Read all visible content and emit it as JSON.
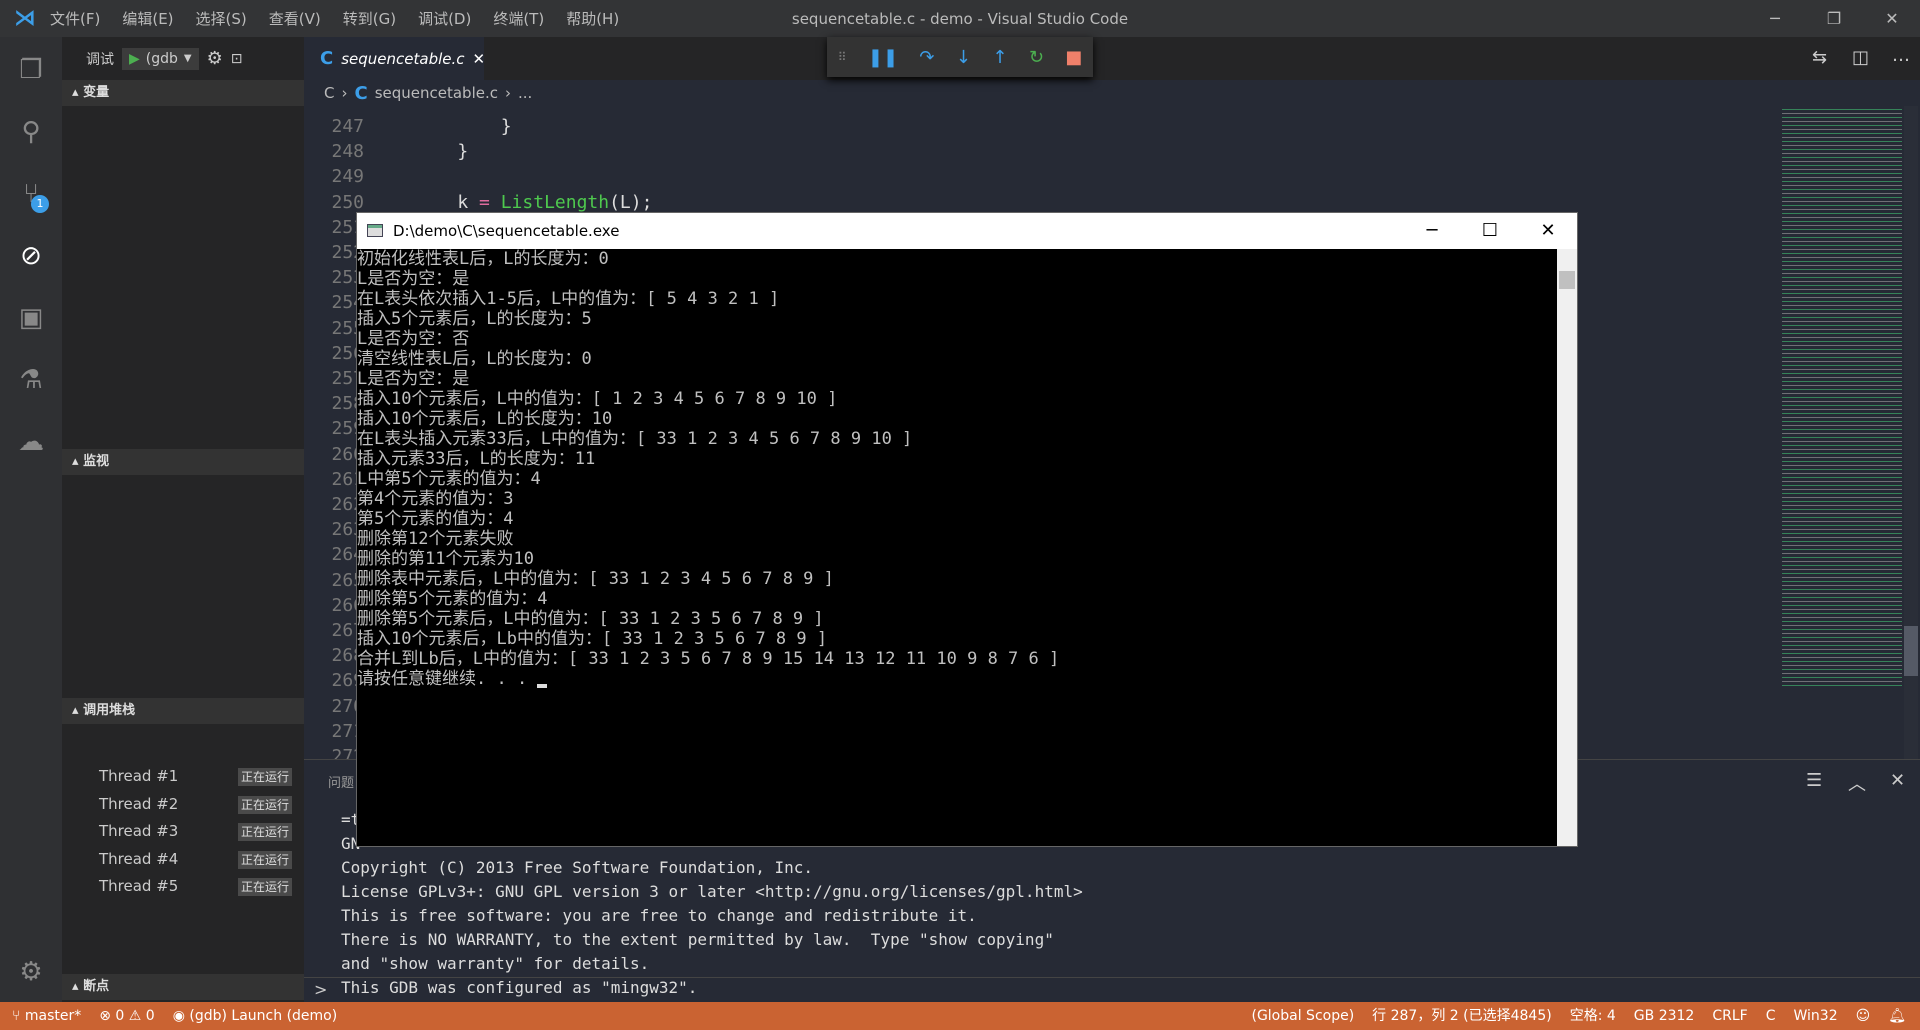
{
  "titlebar": {
    "menus": [
      "文件(F)",
      "编辑(E)",
      "选择(S)",
      "查看(V)",
      "转到(G)",
      "调试(D)",
      "终端(T)",
      "帮助(H)"
    ],
    "title": "sequencetable.c - demo - Visual Studio Code"
  },
  "debug_header": {
    "label": "调试",
    "config": "(gdb"
  },
  "sidebar": {
    "variables": "变量",
    "watch": "监视",
    "callstack": "调用堆栈",
    "breakpoints": "断点",
    "threads": [
      {
        "name": "Thread #1",
        "status": "正在运行"
      },
      {
        "name": "Thread #2",
        "status": "正在运行"
      },
      {
        "name": "Thread #3",
        "status": "正在运行"
      },
      {
        "name": "Thread #4",
        "status": "正在运行"
      },
      {
        "name": "Thread #5",
        "status": "正在运行"
      }
    ]
  },
  "activity": {
    "scm_badge": "1"
  },
  "editor": {
    "tab": "sequencetable.c",
    "breadcrumb": [
      "C",
      "sequencetable.c",
      "..."
    ],
    "lines": [
      {
        "n": "247",
        "code": "        }"
      },
      {
        "n": "248",
        "code": "    }"
      },
      {
        "n": "249",
        "code": ""
      },
      {
        "n": "250",
        "code": "    k = ListLength(L);"
      },
      {
        "n": "251",
        "code": ""
      },
      {
        "n": "252",
        "code": ""
      },
      {
        "n": "253",
        "code": ""
      },
      {
        "n": "254",
        "code": ""
      },
      {
        "n": "255",
        "code": ""
      },
      {
        "n": "256",
        "code": ""
      },
      {
        "n": "257",
        "code": ""
      },
      {
        "n": "258",
        "code": ""
      },
      {
        "n": "259",
        "code": ""
      },
      {
        "n": "260",
        "code": ""
      },
      {
        "n": "261",
        "code": ""
      },
      {
        "n": "262",
        "code": ""
      },
      {
        "n": "263",
        "code": ""
      },
      {
        "n": "264",
        "code": ""
      },
      {
        "n": "265",
        "code": ""
      },
      {
        "n": "266",
        "code": ""
      },
      {
        "n": "267",
        "code": ""
      },
      {
        "n": "268",
        "code": ""
      },
      {
        "n": "269",
        "code": ""
      },
      {
        "n": "270",
        "code": ""
      },
      {
        "n": "271",
        "code": ""
      },
      {
        "n": "272",
        "code": ""
      }
    ]
  },
  "console": {
    "title": "D:\\demo\\C\\sequencetable.exe",
    "lines": [
      "初始化线性表L后，L的长度为：0",
      "L是否为空：是",
      "在L表头依次插入1-5后，L中的值为：[ 5 4 3 2 1 ]",
      "插入5个元素后，L的长度为：5",
      "L是否为空：否",
      "清空线性表L后，L的长度为：0",
      "L是否为空：是",
      "插入10个元素后，L中的值为：[ 1 2 3 4 5 6 7 8 9 10 ]",
      "插入10个元素后，L的长度为：10",
      "在L表头插入元素33后，L中的值为：[ 33 1 2 3 4 5 6 7 8 9 10 ]",
      "插入元素33后，L的长度为：11",
      "L中第5个元素的值为：4",
      "第4个元素的值为：3",
      "第5个元素的值为：4",
      "删除第12个元素失败",
      "删除的第11个元素为10",
      "删除表中元素后，L中的值为：[ 33 1 2 3 4 5 6 7 8 9 ]",
      "删除第5个元素的值为：4",
      "删除第5个元素后，L中的值为：[ 33 1 2 3 5 6 7 8 9 ]",
      "插入10个元素后，Lb中的值为：[ 33 1 2 3 5 6 7 8 9 ]",
      "合并L到Lb后，L中的值为：[ 33 1 2 3 5 6 7 8 9 15 14 13 12 11 10 9 8 7 6 ]",
      "请按任意键继续. . . "
    ]
  },
  "panel": {
    "tab": "问题",
    "lines": [
      "=t",
      "GN",
      "Copyright (C) 2013 Free Software Foundation, Inc.",
      "License GPLv3+: GNU GPL version 3 or later <http://gnu.org/licenses/gpl.html>",
      "This is free software: you are free to change and redistribute it.",
      "There is NO WARRANTY, to the extent permitted by law.  Type \"show copying\"",
      "and \"show warranty\" for details.",
      "This GDB was configured as \"mingw32\"."
    ],
    "prompt": ">"
  },
  "status": {
    "branch": "master*",
    "errors": "0",
    "warnings": "0",
    "launch": "(gdb) Launch (demo)",
    "scope": "(Global Scope)",
    "position": "行 287，列 2 (已选择4845)",
    "spaces": "空格: 4",
    "encoding": "GB 2312",
    "eol": "CRLF",
    "language": "C",
    "platform": "Win32",
    "color": "#ca6332"
  }
}
